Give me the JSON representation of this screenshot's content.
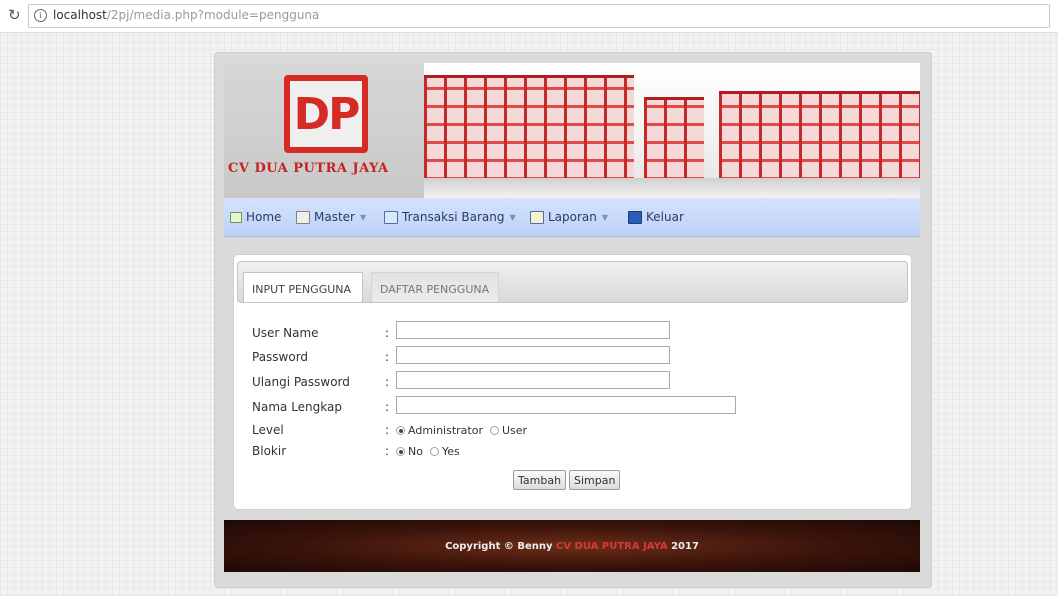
{
  "browser": {
    "url_host": "localhost",
    "url_path": "/2pj/media.php?module=pengguna"
  },
  "header": {
    "logo_letters": "DP",
    "company_name": "CV DUA PUTRA JAYA"
  },
  "nav": {
    "items": [
      {
        "label": "Home",
        "icon": "home-icon"
      },
      {
        "label": "Master",
        "icon": "master-icon"
      },
      {
        "label": "Transaksi Barang",
        "icon": "transaction-icon"
      },
      {
        "label": "Laporan",
        "icon": "report-icon"
      },
      {
        "label": "Keluar",
        "icon": "logout-icon"
      }
    ]
  },
  "tabs": {
    "active": "INPUT PENGGUNA",
    "inactive": "DAFTAR PENGGUNA"
  },
  "form": {
    "colon": ":",
    "username_label": "User Name",
    "password_label": "Password",
    "repeat_password_label": "Ulangi Password",
    "fullname_label": "Nama Lengkap",
    "level_label": "Level",
    "level_options": {
      "admin": "Administrator",
      "user": "User"
    },
    "level_selected": "Administrator",
    "blokir_label": "Blokir",
    "blokir_options": {
      "no": "No",
      "yes": "Yes"
    },
    "blokir_selected": "No",
    "add_button": "Tambah",
    "save_button": "Simpan"
  },
  "footer": {
    "prefix": "Copyright © Benny",
    "brand": "CV DUA PUTRA JAYA",
    "year": "2017"
  },
  "colors": {
    "brand_red": "#d62a25",
    "nav_bg": "#c8daf9",
    "footer_bg": "#3a130a"
  }
}
